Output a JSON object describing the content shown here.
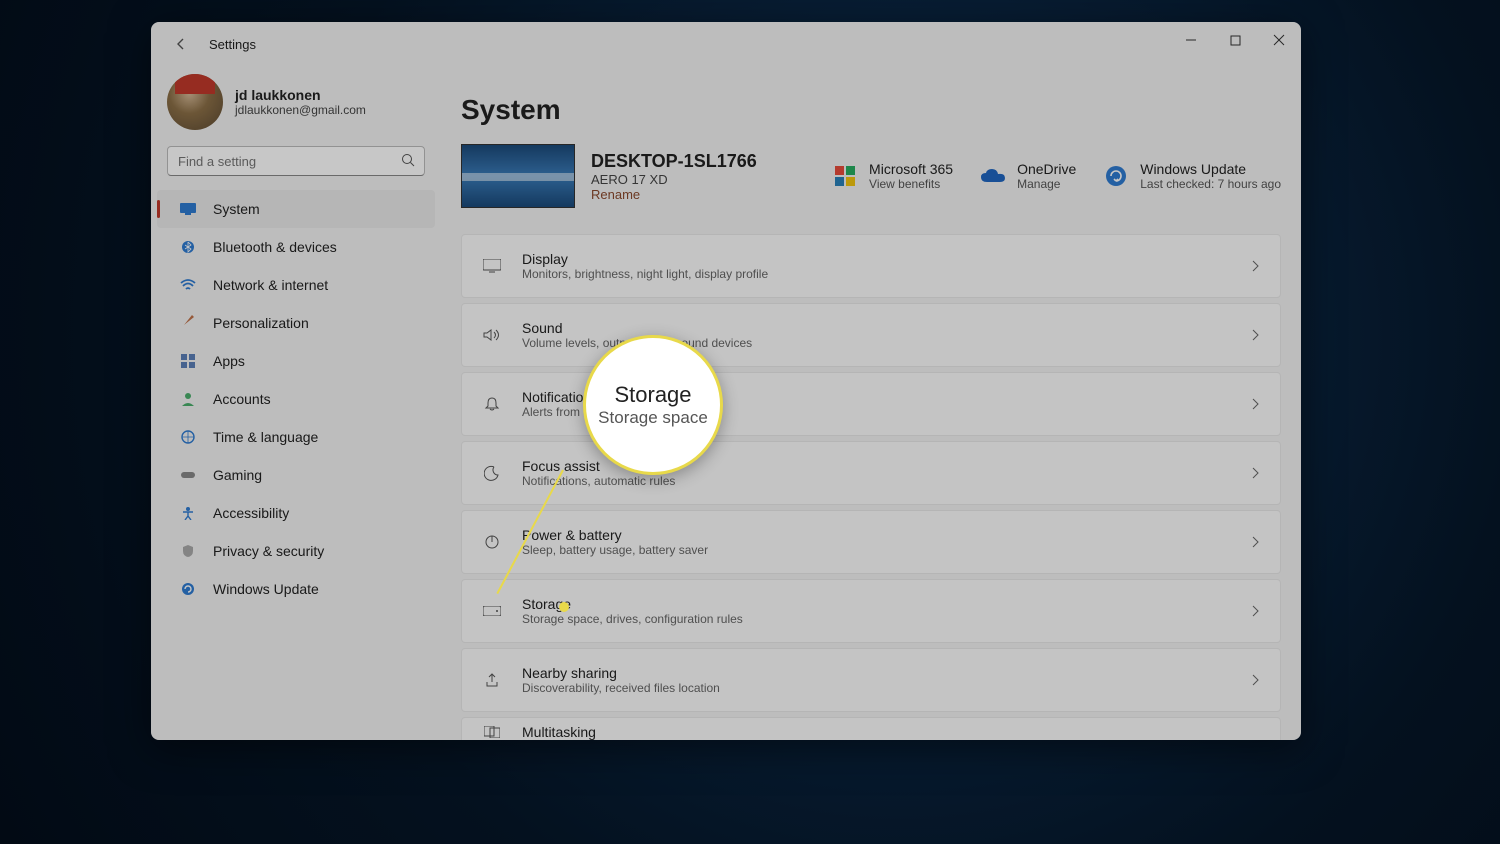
{
  "window": {
    "title": "Settings"
  },
  "profile": {
    "name": "jd laukkonen",
    "email": "jdlaukkonen@gmail.com"
  },
  "search": {
    "placeholder": "Find a setting"
  },
  "nav": {
    "items": [
      {
        "label": "System"
      },
      {
        "label": "Bluetooth & devices"
      },
      {
        "label": "Network & internet"
      },
      {
        "label": "Personalization"
      },
      {
        "label": "Apps"
      },
      {
        "label": "Accounts"
      },
      {
        "label": "Time & language"
      },
      {
        "label": "Gaming"
      },
      {
        "label": "Accessibility"
      },
      {
        "label": "Privacy & security"
      },
      {
        "label": "Windows Update"
      }
    ]
  },
  "main": {
    "heading": "System",
    "device": {
      "name": "DESKTOP-1SL1766",
      "model": "AERO 17 XD",
      "rename": "Rename"
    },
    "tiles": {
      "m365": {
        "title": "Microsoft 365",
        "sub": "View benefits"
      },
      "onedrive": {
        "title": "OneDrive",
        "sub": "Manage"
      },
      "update": {
        "title": "Windows Update",
        "sub": "Last checked: 7 hours ago"
      }
    },
    "rows": [
      {
        "title": "Display",
        "sub": "Monitors, brightness, night light, display profile"
      },
      {
        "title": "Sound",
        "sub": "Volume levels, output, input, sound devices"
      },
      {
        "title": "Notifications",
        "sub": "Alerts from apps and system"
      },
      {
        "title": "Focus assist",
        "sub": "Notifications, automatic rules"
      },
      {
        "title": "Power & battery",
        "sub": "Sleep, battery usage, battery saver"
      },
      {
        "title": "Storage",
        "sub": "Storage space, drives, configuration rules"
      },
      {
        "title": "Nearby sharing",
        "sub": "Discoverability, received files location"
      },
      {
        "title": "Multitasking",
        "sub": ""
      }
    ]
  },
  "callout": {
    "title": "Storage",
    "sub": "Storage space"
  }
}
